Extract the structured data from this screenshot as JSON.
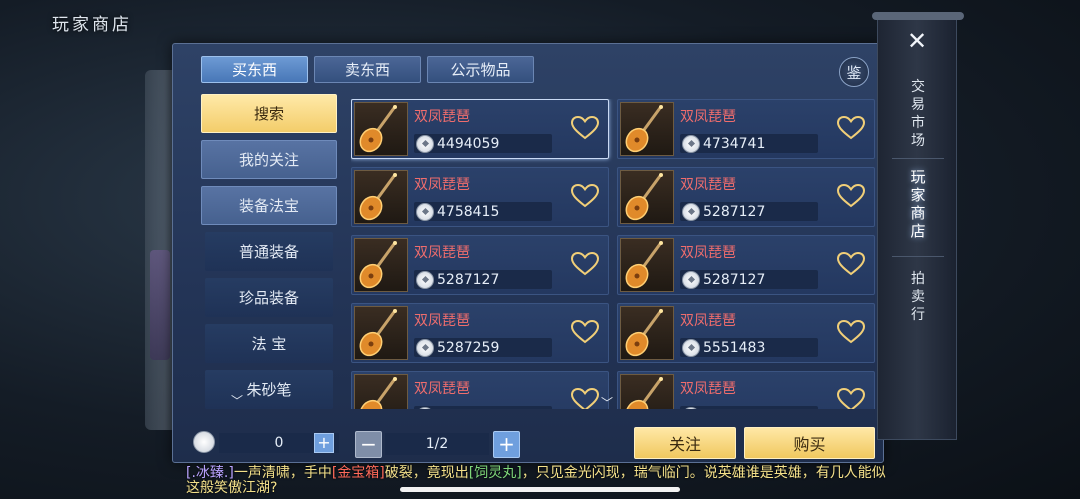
{
  "page_title": "玩家商店",
  "tabs": [
    {
      "label": "买东西",
      "active": true
    },
    {
      "label": "卖东西",
      "active": false
    },
    {
      "label": "公示物品",
      "active": false
    }
  ],
  "appraise_label": "鉴",
  "sidebar": [
    {
      "label": "搜索",
      "style": "primary"
    },
    {
      "label": "我的关注",
      "style": "sub"
    },
    {
      "label": "装备法宝",
      "style": "sub"
    },
    {
      "label": "普通装备",
      "style": "child"
    },
    {
      "label": "珍品装备",
      "style": "child"
    },
    {
      "label": "法 宝",
      "style": "child"
    },
    {
      "label": "朱砂笔",
      "style": "child"
    }
  ],
  "items": [
    {
      "name": "双凤琵琶",
      "price": "4494059"
    },
    {
      "name": "双凤琵琶",
      "price": "4734741"
    },
    {
      "name": "双凤琵琶",
      "price": "4758415"
    },
    {
      "name": "双凤琵琶",
      "price": "5287127"
    },
    {
      "name": "双凤琵琶",
      "price": "5287127"
    },
    {
      "name": "双凤琵琶",
      "price": "5287127"
    },
    {
      "name": "双凤琵琶",
      "price": "5287259"
    },
    {
      "name": "双凤琵琶",
      "price": "5551483"
    },
    {
      "name": "双凤琵琶",
      "price": ""
    },
    {
      "name": "双凤琵琶",
      "price": ""
    }
  ],
  "footer": {
    "balance": "0",
    "plus": "+",
    "minus": "−",
    "next": "+",
    "page": "1/2",
    "follow_label": "关注",
    "buy_label": "购买"
  },
  "right_nav": {
    "close": "✕",
    "items": [
      "交易市场",
      "玩家商店",
      "拍卖行"
    ]
  },
  "chat": {
    "channel": "[.冰臻.]",
    "text1": "一声清啸，手中",
    "item1": "[金宝箱]",
    "text2": "破裂，竟现出",
    "item2": "[饲灵丸]",
    "text3": "，只见金光闪现，瑞气临门。说英雄谁是英雄，有几人能似这般笑傲江湖?"
  },
  "colors": {
    "panel": "#2e4266",
    "gold_button": "#f0c85f",
    "item_name": "#f06d6d",
    "chat_text": "#f3e08a"
  }
}
